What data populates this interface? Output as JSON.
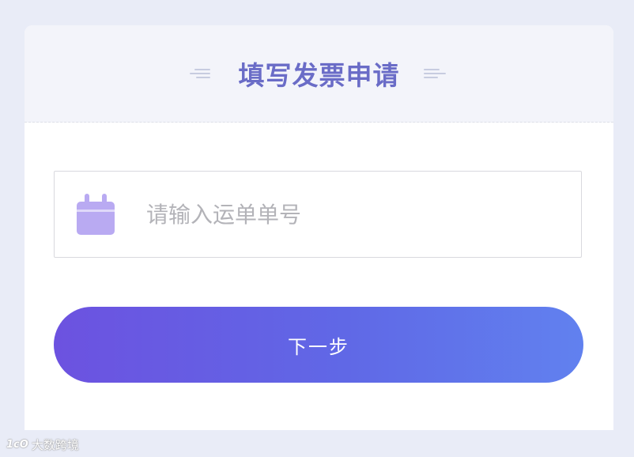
{
  "header": {
    "title": "填写发票申请"
  },
  "form": {
    "input": {
      "placeholder": "请输入运单单号",
      "value": "",
      "icon": "calendar-icon"
    },
    "next_button_label": "下一步"
  },
  "watermark": {
    "logo_text": "1cO",
    "text": "大数跨境"
  },
  "colors": {
    "page_bg": "#e9ecf7",
    "header_bg": "#f3f4fa",
    "title": "#6a6cc7",
    "icon": "#b9aaf2",
    "button_gradient_start": "#6c52e0",
    "button_gradient_end": "#6181ef"
  }
}
